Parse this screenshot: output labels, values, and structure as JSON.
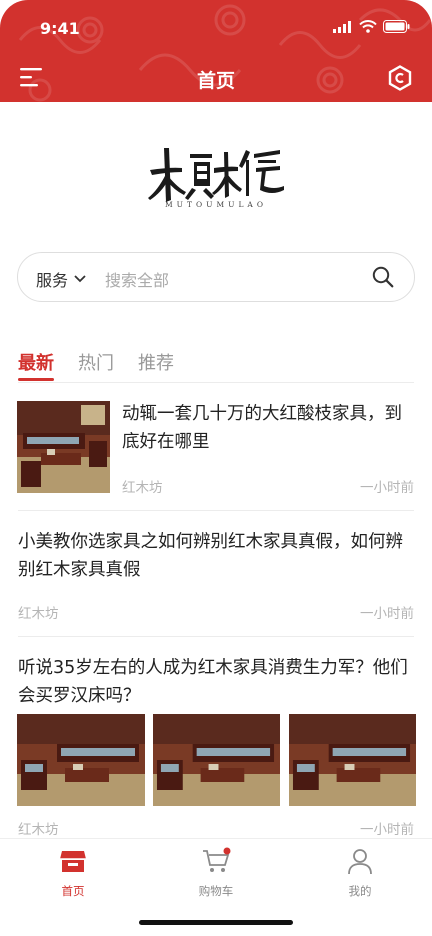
{
  "status_bar": {
    "time": "9:41"
  },
  "nav": {
    "title": "首页"
  },
  "logo": {
    "text": "木頭木佬",
    "subtext": "MUTOUMULAO"
  },
  "search": {
    "scope": "服务",
    "placeholder": "搜索全部"
  },
  "tabs": [
    {
      "label": "最新",
      "active": true
    },
    {
      "label": "热门",
      "active": false
    },
    {
      "label": "推荐",
      "active": false
    }
  ],
  "articles": [
    {
      "title": "动辄一套几十万的大红酸枝家具，到底好在哪里",
      "source": "红木坊",
      "time": "一小时前"
    },
    {
      "title": "小美教你选家具之如何辨别红木家具真假，如何辨别红木家具真假",
      "source": "红木坊",
      "time": "一小时前"
    },
    {
      "title": "听说35岁左右的人成为红木家具消费生力军？他们会买罗汉床吗？",
      "source": "红木坊",
      "time": "一小时前"
    }
  ],
  "tabbar": [
    {
      "label": "首页",
      "icon": "shop-icon",
      "active": true
    },
    {
      "label": "购物车",
      "icon": "cart-icon",
      "active": false,
      "badge": true
    },
    {
      "label": "我的",
      "icon": "user-icon",
      "active": false
    }
  ],
  "colors": {
    "brand": "#d2322e",
    "muted": "#b5b5b5",
    "divider": "#ececec"
  }
}
